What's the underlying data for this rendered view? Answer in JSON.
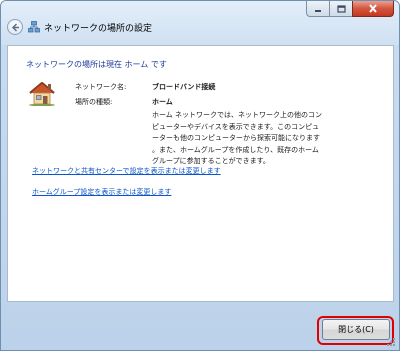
{
  "window": {
    "title": "ネットワークの場所の設定"
  },
  "content": {
    "heading": "ネットワークの場所は現在 ホーム です",
    "network_name_label": "ネットワーク名:",
    "network_name_value": "ブロードバンド接続",
    "location_type_label": "場所の種類:",
    "location_type_value": "ホーム",
    "description_lines": [
      "ホーム ネットワークでは、ネットワーク上の他のコン",
      "ピューターやデバイスを表示できます。このコンピュ",
      "ーターも他のコンピューターから探索可能になります",
      "。また、ホームグループを作成したり、既存のホーム",
      "グループに参加することができます。"
    ],
    "links": {
      "network_center": "ネットワークと共有センターで設定を表示または変更します",
      "homegroup": "ホームグループ設定を表示または変更します"
    }
  },
  "footer": {
    "close_label": "閉じる(C)"
  },
  "colors": {
    "heading": "#1e3b9a",
    "link": "#0b54cc",
    "highlight": "#e00000",
    "close_caption": "#c3381f"
  }
}
